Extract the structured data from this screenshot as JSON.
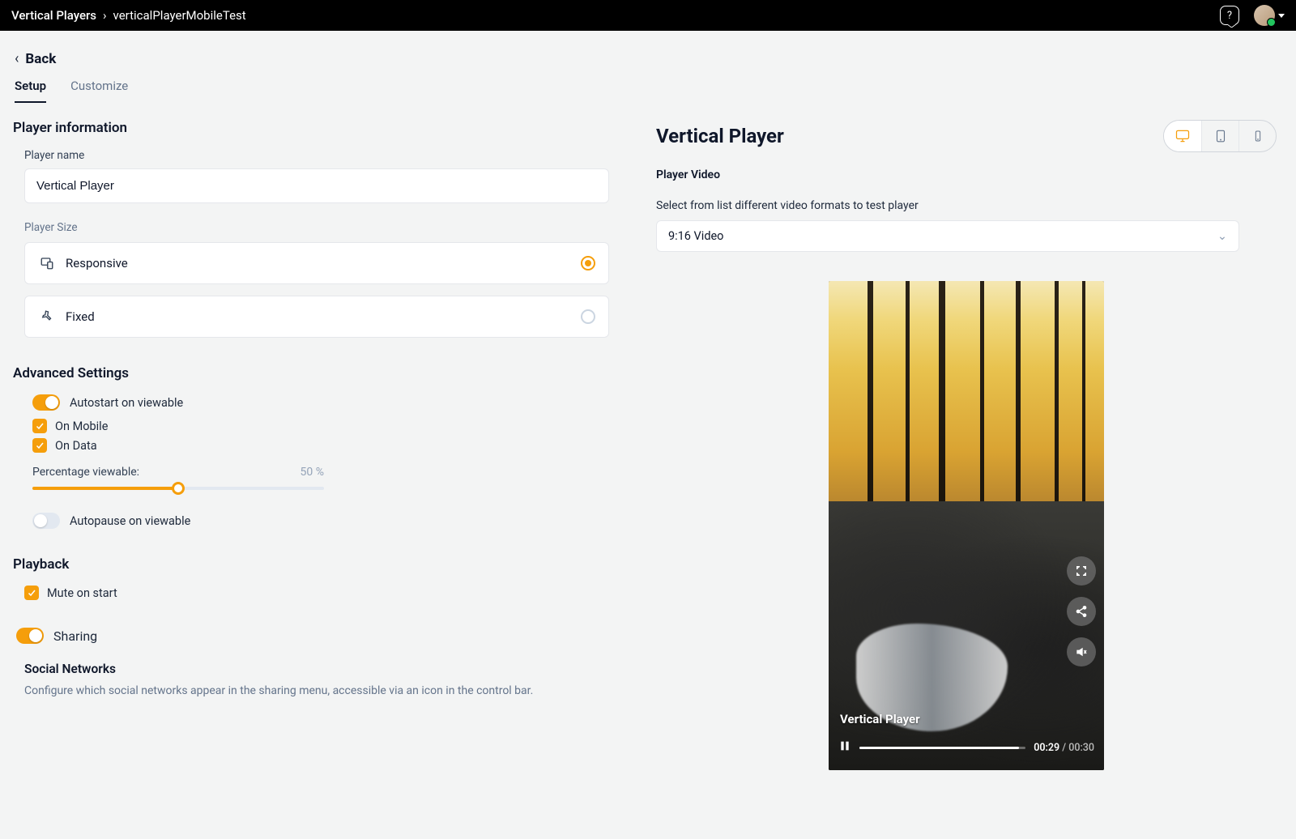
{
  "breadcrumbs": {
    "root": "Vertical Players",
    "current": "verticalPlayerMobileTest"
  },
  "back_label": "Back",
  "tabs": {
    "setup": "Setup",
    "customize": "Customize",
    "active": "setup"
  },
  "player_info": {
    "heading": "Player information",
    "name_label": "Player name",
    "name_value": "Vertical Player",
    "size_label": "Player Size",
    "options": {
      "responsive": "Responsive",
      "fixed": "Fixed",
      "selected": "responsive"
    }
  },
  "advanced": {
    "heading": "Advanced Settings",
    "autostart": {
      "label": "Autostart on viewable",
      "on": true
    },
    "on_mobile": {
      "label": "On Mobile",
      "checked": true
    },
    "on_data": {
      "label": "On Data",
      "checked": true
    },
    "viewable": {
      "label": "Percentage viewable:",
      "value_text": "50 %",
      "value": 50
    },
    "autopause": {
      "label": "Autopause on viewable",
      "on": false
    }
  },
  "playback": {
    "heading": "Playback",
    "mute": {
      "label": "Mute on start",
      "checked": true
    }
  },
  "sharing": {
    "toggle_label": "Sharing",
    "toggle_on": true,
    "networks_heading": "Social Networks",
    "networks_desc": "Configure which social networks appear in the sharing menu, accessible via an icon in the control bar."
  },
  "preview": {
    "title": "Vertical Player",
    "video_label": "Player Video",
    "format_instruction": "Select from list different video formats to test player",
    "format_selected": "9:16 Video",
    "overlay_title": "Vertical Player",
    "time_current": "00:29",
    "time_total": "00:30"
  }
}
